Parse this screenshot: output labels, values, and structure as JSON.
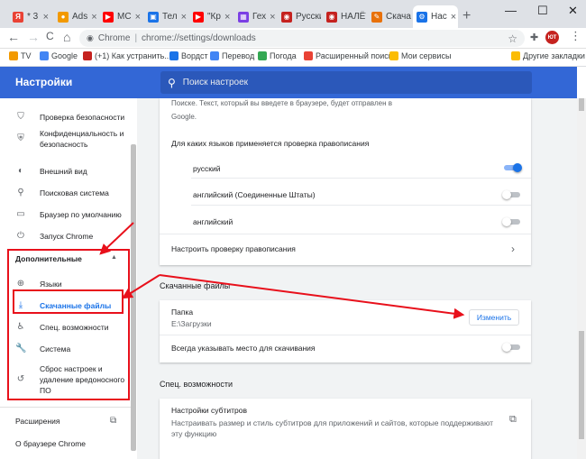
{
  "tabs": [
    {
      "label": "* 3",
      "color": "#e94235",
      "glyph": "Я"
    },
    {
      "label": "Ads",
      "color": "#f29900",
      "glyph": "●"
    },
    {
      "label": "МС",
      "color": "#ff0000",
      "glyph": "▶"
    },
    {
      "label": "Тел",
      "color": "#1a73e8",
      "glyph": "▣"
    },
    {
      "label": "\"Кр",
      "color": "#ff0000",
      "glyph": "▶"
    },
    {
      "label": "Гех",
      "color": "#7b3fe4",
      "glyph": "▦"
    },
    {
      "label": "Русских",
      "color": "#c5221f",
      "glyph": "◉"
    },
    {
      "label": "НАЛЁТ",
      "color": "#c5221f",
      "glyph": "◉"
    },
    {
      "label": "Скачать",
      "color": "#e8710a",
      "glyph": "✎"
    },
    {
      "label": "Нас",
      "color": "#1a73e8",
      "glyph": "⚙"
    }
  ],
  "window": {
    "new_tab": "+",
    "minimize": "—",
    "maximize": "☐",
    "close": "✕"
  },
  "toolbar": {
    "back": "←",
    "forward": "→",
    "reload": "C",
    "home": "⌂",
    "omnibox_chip": "Chrome",
    "omnibox_sep": "|",
    "url": "chrome://settings/downloads",
    "star": "☆",
    "puzzle": "✚",
    "avatar": "ЮТ",
    "menu": "⋮"
  },
  "bookmarks": [
    {
      "label": "TV",
      "color": "#f29900"
    },
    {
      "label": "Google",
      "color": "#4285f4"
    },
    {
      "label": "(+1) Как устранить...",
      "color": "#c5221f"
    },
    {
      "label": "Вордст",
      "color": "#1a73e8"
    },
    {
      "label": "Перевод",
      "color": "#4285f4"
    },
    {
      "label": "Погода",
      "color": "#34a853"
    },
    {
      "label": "Расширенный поиск",
      "color": "#e94235"
    },
    {
      "label": "Мои сервисы",
      "color": "#fbbc04"
    },
    {
      "label": "Другие закладки",
      "color": "#fbbc04"
    }
  ],
  "header": {
    "title": "Настройки",
    "search_placeholder": "Поиск настроек"
  },
  "sidebar": {
    "items": [
      {
        "icon": "⛉",
        "label": "Проверка безопасности"
      },
      {
        "icon": "⛨",
        "label": "Конфиденциальность и безопасность"
      },
      {
        "icon": "◐",
        "label": "Внешний вид"
      },
      {
        "icon": "⚲",
        "label": "Поисковая система"
      },
      {
        "icon": "▭",
        "label": "Браузер по умолчанию"
      },
      {
        "icon": "⏻",
        "label": "Запуск Chrome"
      }
    ],
    "advanced_title": "Дополнительные",
    "advanced_chevron": "▲",
    "advanced_items": [
      {
        "icon": "⊕",
        "label": "Языки"
      },
      {
        "icon": "⤓",
        "label": "Скачанные файлы"
      },
      {
        "icon": "♿",
        "label": "Спец. возможности"
      },
      {
        "icon": "🔧",
        "label": "Система"
      },
      {
        "icon": "↺",
        "label": "Сброс настроек и удаление вредоносного ПО"
      }
    ],
    "extensions": "Расширения",
    "extensions_icon": "⧉",
    "about": "О браузере Chrome"
  },
  "spell": {
    "text_top": "Поиске. Текст, который вы введете в браузере, будет отправлен в",
    "text_bottom": "Google.",
    "languages_heading": "Для каких языков применяется проверка правописания",
    "languages": [
      {
        "label": "русский",
        "enabled": true
      },
      {
        "label": "английский (Соединенные Штаты)",
        "enabled": false
      },
      {
        "label": "английский",
        "enabled": false
      }
    ],
    "customize": "Настроить проверку правописания",
    "chevron": "›"
  },
  "downloads": {
    "section_title": "Скачанные файлы",
    "folder_label": "Папка",
    "folder_path": "E:\\Загрузки",
    "change_button": "Изменить",
    "ask_where": "Всегда указывать место для скачивания",
    "ask_enabled": false
  },
  "accessibility": {
    "section_title": "Спец. возможности",
    "captions_title": "Настройки субтитров",
    "captions_desc": "Настраивать размер и стиль субтитров для приложений и сайтов, которые поддерживают эту функцию",
    "external_icon": "⧉"
  },
  "colors": {
    "header": "#3367d6",
    "accent": "#1a73e8",
    "annotation": "#e8101b"
  }
}
